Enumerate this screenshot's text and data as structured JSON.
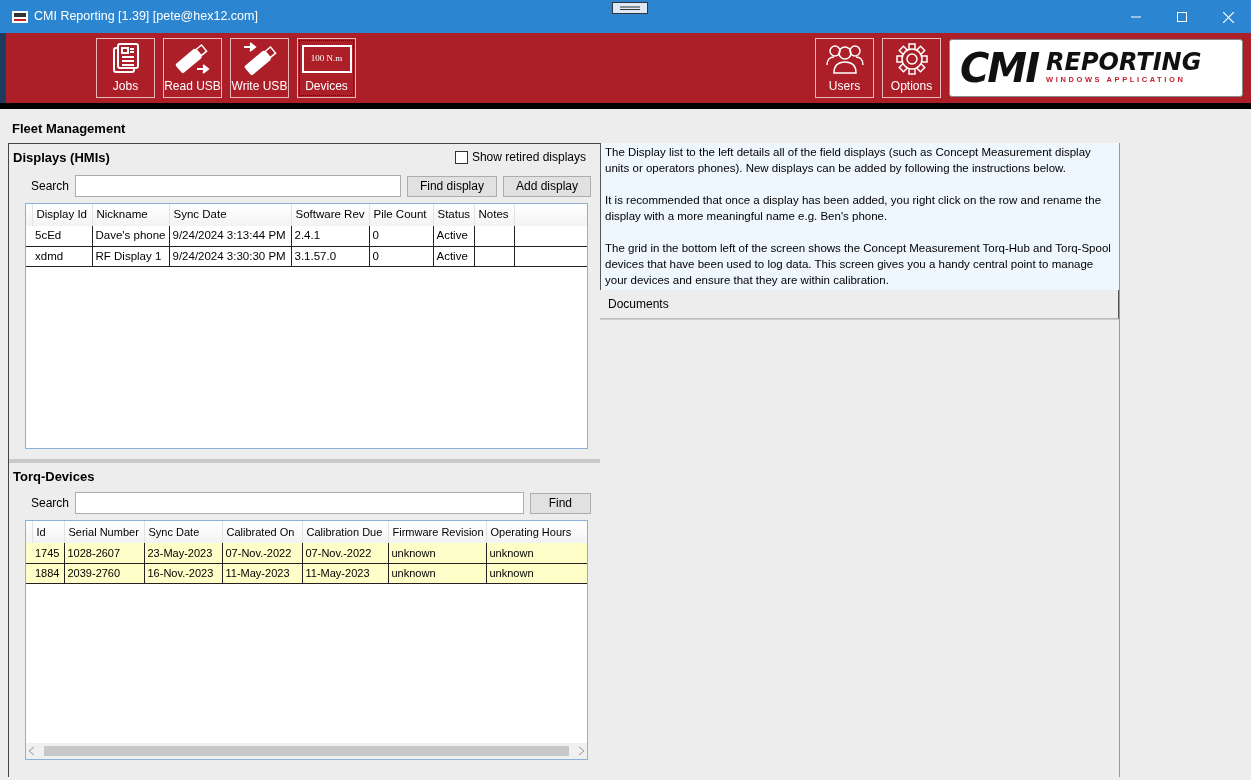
{
  "window": {
    "title": "CMI Reporting [1.39]  [pete@hex12.com]"
  },
  "toolbar": {
    "left": [
      {
        "label": "Jobs",
        "kind": "jobs"
      },
      {
        "label": "Read USB",
        "kind": "readusb"
      },
      {
        "label": "Write USB",
        "kind": "writeusb"
      },
      {
        "label": "Devices",
        "kind": "devices",
        "screen_text": "100 N.m",
        "focused": true
      }
    ],
    "right": [
      {
        "label": "Users",
        "kind": "users"
      },
      {
        "label": "Options",
        "kind": "options"
      }
    ],
    "logo": {
      "mark": "CMI",
      "title": "REPORTING",
      "subtitle": "WINDOWS APPLICATION"
    }
  },
  "page_title": "Fleet Management",
  "displays": {
    "title": "Displays (HMIs)",
    "show_retired": {
      "label": "Show retired displays",
      "checked": false
    },
    "search_label": "Search",
    "buttons": [
      "Find display",
      "Add display"
    ],
    "columns": [
      "Display Id",
      "Nickname",
      "Sync Date",
      "Software Rev",
      "Pile Count",
      "Status",
      "Notes"
    ],
    "rows": [
      [
        "5cEd",
        "Dave's phone",
        "9/24/2024 3:13:44 PM",
        "2.4.1",
        "0",
        "Active",
        ""
      ],
      [
        "xdmd",
        "RF Display 1",
        "9/24/2024 3:30:30 PM",
        "3.1.57.0",
        "0",
        "Active",
        ""
      ]
    ]
  },
  "torq_devices": {
    "title": "Torq-Devices",
    "search_label": "Search",
    "buttons": [
      "Find"
    ],
    "columns": [
      "Id",
      "Serial Number",
      "Sync Date",
      "Calibrated On",
      "Calibration Due",
      "Firmware Revision",
      "Operating Hours"
    ],
    "rows": [
      [
        "1745",
        "1028-2607",
        "23-May-2023",
        "07-Nov.-2022",
        "07-Nov.-2022",
        "unknown",
        "unknown"
      ],
      [
        "1884",
        "2039-2760",
        "16-Nov.-2023",
        "11-May-2023",
        "11-May-2023",
        "unknown",
        "unknown"
      ]
    ]
  },
  "info": {
    "paragraphs": [
      "The Display list to the left details all of the field displays (such as Concept Measurement display units or operators phones). New displays can be added by following the instructions below.",
      "It is recommended that once a display has been added, you right click on the row and rename the display with a more meaningful name e.g. Ben's phone.",
      "The grid in the bottom left of the screen shows the Concept Measurement Torq-Hub and Torq-Spool devices that have been used to log data. This screen gives you a handy central point to manage your devices and ensure that they are within calibration."
    ]
  },
  "documents": {
    "title": "Documents"
  }
}
